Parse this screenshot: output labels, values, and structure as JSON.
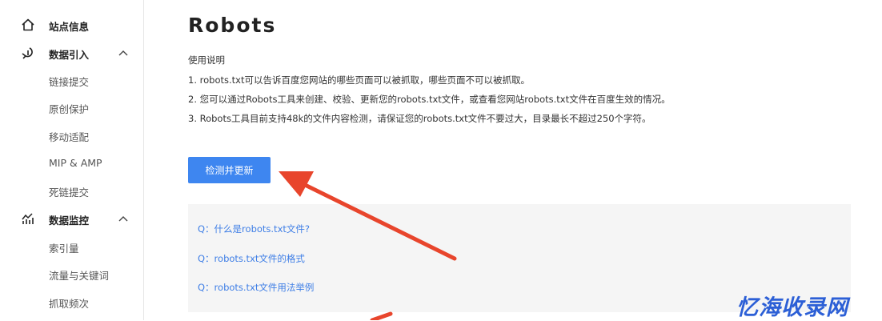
{
  "sidebar": {
    "groups": [
      {
        "label": "站点信息",
        "icon": "home-icon"
      },
      {
        "label": "数据引入",
        "icon": "data-import-icon",
        "chevron": "chevron-up-icon",
        "items": [
          "链接提交",
          "原创保护",
          "移动适配",
          "MIP & AMP",
          "死链提交"
        ]
      },
      {
        "label": "数据监控",
        "icon": "chart-icon",
        "chevron": "chevron-up-icon",
        "items": [
          "索引量",
          "流量与关键词",
          "抓取频次"
        ]
      }
    ]
  },
  "main": {
    "title": "Robots",
    "usage_title": "使用说明",
    "usage_lines": [
      "1. robots.txt可以告诉百度您网站的哪些页面可以被抓取，哪些页面不可以被抓取。",
      "2. 您可以通过Robots工具来创建、校验、更新您的robots.txt文件，或查看您网站robots.txt文件在百度生效的情况。",
      "3. Robots工具目前支持48k的文件内容检测，请保证您的robots.txt文件不要过大，目录最长不超过250个字符。"
    ],
    "button_label": "检测并更新",
    "faq": [
      "Q：什么是robots.txt文件?",
      "Q：robots.txt文件的格式",
      "Q：robots.txt文件用法举例"
    ]
  },
  "watermark": "忆海收录网",
  "colors": {
    "accent": "#3e86f0",
    "link": "#3e7ee6",
    "arrow": "#e8452c",
    "watermark": "#2c5fd6"
  }
}
